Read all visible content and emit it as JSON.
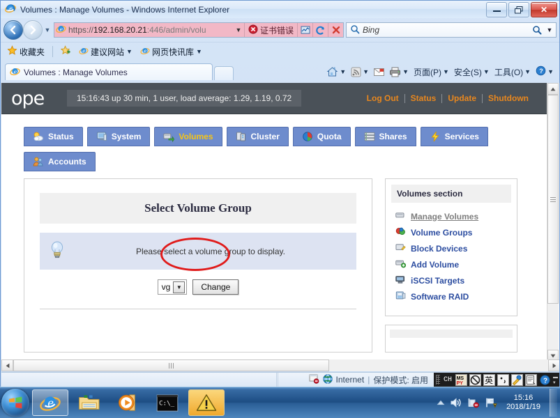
{
  "browser": {
    "window_title": "Volumes : Manage Volumes - Windows Internet Explorer",
    "minimize_label": "–",
    "restore_label": "❐",
    "close_label": "✕",
    "back_label": "←",
    "forward_label": "→",
    "recent_pages_caret": "▼",
    "address": {
      "scheme": "https://",
      "host": "192.168.20.21",
      "rest": ":446/admin/volu",
      "full": "https://192.168.20.21:446/admin/volu",
      "dropdown_caret": "▼",
      "cert_error_label": "证书错误",
      "compat_button": "compatibility-view",
      "refresh_button": "↻",
      "stop_button": "✕"
    },
    "search": {
      "provider": "Bing",
      "go_label": "⌕",
      "caret": "▼"
    },
    "favorites_bar": {
      "favorites_label": "收藏夹",
      "items": [
        {
          "label": "建议网站",
          "caret": "▼"
        },
        {
          "label": "网页快讯库",
          "caret": "▼"
        }
      ]
    },
    "tab": {
      "label": "Volumes : Manage Volumes"
    },
    "command_bar": [
      {
        "name": "home",
        "label": "",
        "caret": "▼"
      },
      {
        "name": "feeds",
        "label": "",
        "caret": "▼"
      },
      {
        "name": "mail",
        "label": "",
        "caret": ""
      },
      {
        "name": "print",
        "label": "",
        "caret": "▼"
      },
      {
        "name": "page",
        "label": "页面(P)",
        "caret": "▼"
      },
      {
        "name": "safety",
        "label": "安全(S)",
        "caret": "▼"
      },
      {
        "name": "tools",
        "label": "工具(O)",
        "caret": "▼"
      },
      {
        "name": "help",
        "label": "",
        "caret": "▼"
      }
    ],
    "status_bar": {
      "zone": "Internet",
      "separator": "|",
      "protected_mode": "保护模式: 启用"
    },
    "ime": {
      "lang": "CH",
      "engine": "MSPY",
      "mode_disabled": "⃠",
      "mode_label": "英",
      "punct_label": "·,",
      "tools_label": "tools",
      "soft_kb_label": "keyboard",
      "help_label": "?"
    }
  },
  "openfiler": {
    "logo": "ope",
    "uptime": "15:16:43 up 30 min, 1 user, load average: 1.29, 1.19, 0.72",
    "header_links": [
      "Log Out",
      "Status",
      "Update",
      "Shutdown"
    ],
    "tabs": [
      {
        "label": "Status",
        "icon": "weather-icon",
        "active": false
      },
      {
        "label": "System",
        "icon": "monitor-icon",
        "active": false
      },
      {
        "label": "Volumes",
        "icon": "volume-icon",
        "active": true
      },
      {
        "label": "Cluster",
        "icon": "cluster-icon",
        "active": false
      },
      {
        "label": "Quota",
        "icon": "piechart-icon",
        "active": false
      },
      {
        "label": "Shares",
        "icon": "shares-icon",
        "active": false
      },
      {
        "label": "Services",
        "icon": "bolt-icon",
        "active": false
      },
      {
        "label": "Accounts",
        "icon": "users-icon",
        "active": false
      }
    ],
    "main": {
      "panel_title": "Select Volume Group",
      "info_message": "Please select a volume group to display.",
      "select_value": "vg",
      "select_caret": "▼",
      "change_button": "Change"
    },
    "sidebar": {
      "heading": "Volumes section",
      "links": [
        {
          "label": "Manage Volumes",
          "icon": "volume-icon",
          "current": true
        },
        {
          "label": "Volume Groups",
          "icon": "group-icon",
          "current": false
        },
        {
          "label": "Block Devices",
          "icon": "blockdev-icon",
          "current": false
        },
        {
          "label": "Add Volume",
          "icon": "add-volume-icon",
          "current": false
        },
        {
          "label": "iSCSI Targets",
          "icon": "iscsi-icon",
          "current": false
        },
        {
          "label": "Software RAID",
          "icon": "raid-icon",
          "current": false
        }
      ]
    }
  },
  "annotations": [
    {
      "name": "volumes-tab-highlight",
      "color": "#e01b1b",
      "shape": "ellipse"
    },
    {
      "name": "iscsi-targets-highlight",
      "color": "#e01b1b",
      "shape": "ellipse"
    }
  ],
  "taskbar": {
    "start_label": "start",
    "items": [
      {
        "name": "internet-explorer",
        "active": true,
        "warn": false
      },
      {
        "name": "windows-explorer",
        "active": false,
        "warn": false
      },
      {
        "name": "media-player",
        "active": false,
        "warn": false
      },
      {
        "name": "command-prompt",
        "active": false,
        "warn": false
      },
      {
        "name": "warning-window",
        "active": false,
        "warn": true
      }
    ],
    "tray": {
      "show_hidden": "▲",
      "volume": "volume-icon",
      "network": "network-icon",
      "action_center": "flag-icon"
    },
    "clock_time": "15:16",
    "clock_date": "2018/1/19"
  }
}
